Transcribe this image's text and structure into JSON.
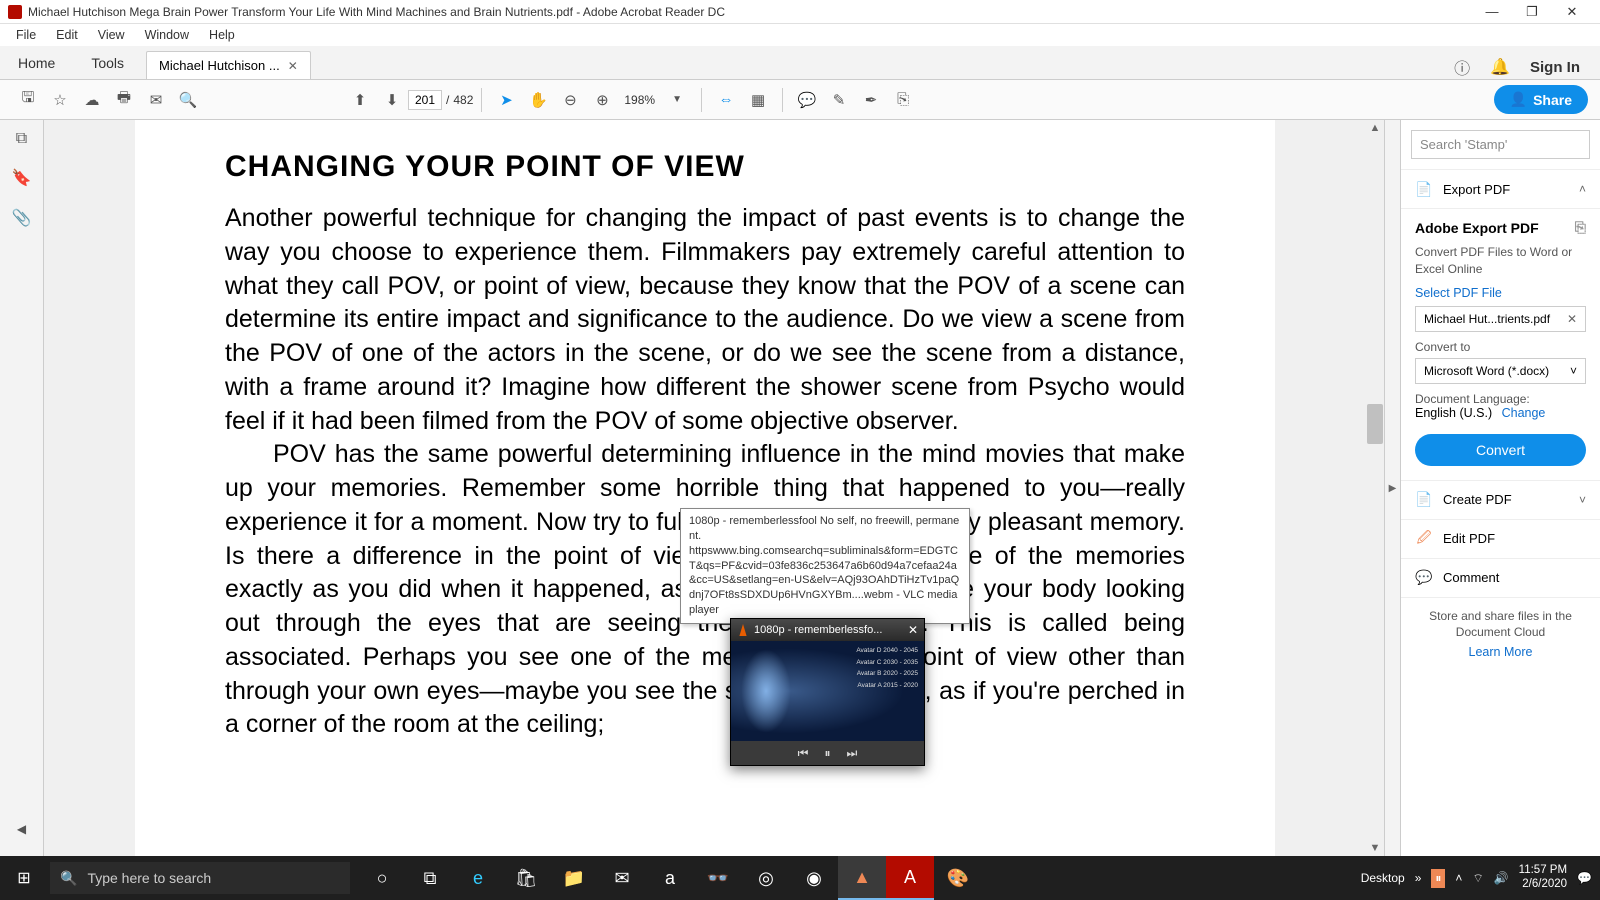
{
  "title": "Michael Hutchison Mega Brain Power Transform Your Life With Mind Machines and Brain Nutrients.pdf - Adobe Acrobat Reader DC",
  "menu": [
    "File",
    "Edit",
    "View",
    "Window",
    "Help"
  ],
  "tabs": {
    "home": "Home",
    "tools": "Tools",
    "doc": "Michael Hutchison ..."
  },
  "signin": "Sign In",
  "page": {
    "current": "201",
    "total": "482"
  },
  "zoom": "198%",
  "share": "Share",
  "doc": {
    "h1": "CHANGING YOUR POINT OF VIEW",
    "p1": "Another powerful technique for changing the impact of past events is to change the way you choose to experience them. Filmmakers pay extremely careful attention to what they call POV, or point of view, because they know that the POV of a scene can determine its entire impact and significance to the audience. Do we view a scene from the POV of one of the actors in the scene, or do we see the scene from a distance, with a frame around it? Imagine how different the shower scene from Psycho would feel if it had been filmed from the POV of some objective observer.",
    "p2": "POV has the same powerful determining influence in the mind movies that make up your memories. Remember some horrible thing that happened to you—really experience it for a moment. Now try to fully experience an extremely pleasant memory. Is there a difference in the point of view? Perhaps you see one of the memories exactly as you did when it happened, as if you are actually inside your body looking out through the eyes that are seeing the events happen. This is called being associated. Perhaps you see one of the memories from a point of view other than through your own eyes—maybe you see the scene from above, as if you're perched in a corner of the room at the ceiling;"
  },
  "right": {
    "searchPlaceholder": "Search 'Stamp'",
    "exportPDF": "Export PDF",
    "adobeExport": "Adobe Export PDF",
    "convertDesc": "Convert PDF Files to Word or Excel Online",
    "selectFile": "Select PDF File",
    "fileName": "Michael Hut...trients.pdf",
    "convertTo": "Convert to",
    "format": "Microsoft Word (*.docx)",
    "docLang": "Document Language:",
    "lang": "English (U.S.)",
    "change": "Change",
    "convert": "Convert",
    "createPDF": "Create PDF",
    "editPDF": "Edit PDF",
    "comment": "Comment",
    "storeShare": "Store and share files in the Document Cloud",
    "learnMore": "Learn More"
  },
  "tooltip": {
    "l1": "1080p - rememberlessfool No self, no freewill, permanent.",
    "l2": "httpswww.bing.comsearchq=subliminals&form=EDGTCT&qs=PF&cvid=03fe836c253647a6b60d94a7cefaa24a&cc=US&setlang=en-US&elv=AQj93OAhDTiHzTv1paQdnj7OFt8sSDXDUp6HVnGXYBm....webm - VLC media player"
  },
  "vlc": {
    "title": "1080p - rememberlessfo...",
    "rows": [
      "Avatar D 2040 - 2045",
      "Avatar C 2030 - 2035",
      "Avatar B 2020 - 2025",
      "Avatar A 2015 - 2020"
    ]
  },
  "taskbar": {
    "search": "Type here to search",
    "desktop": "Desktop",
    "time": "11:57 PM",
    "date": "2/6/2020"
  }
}
